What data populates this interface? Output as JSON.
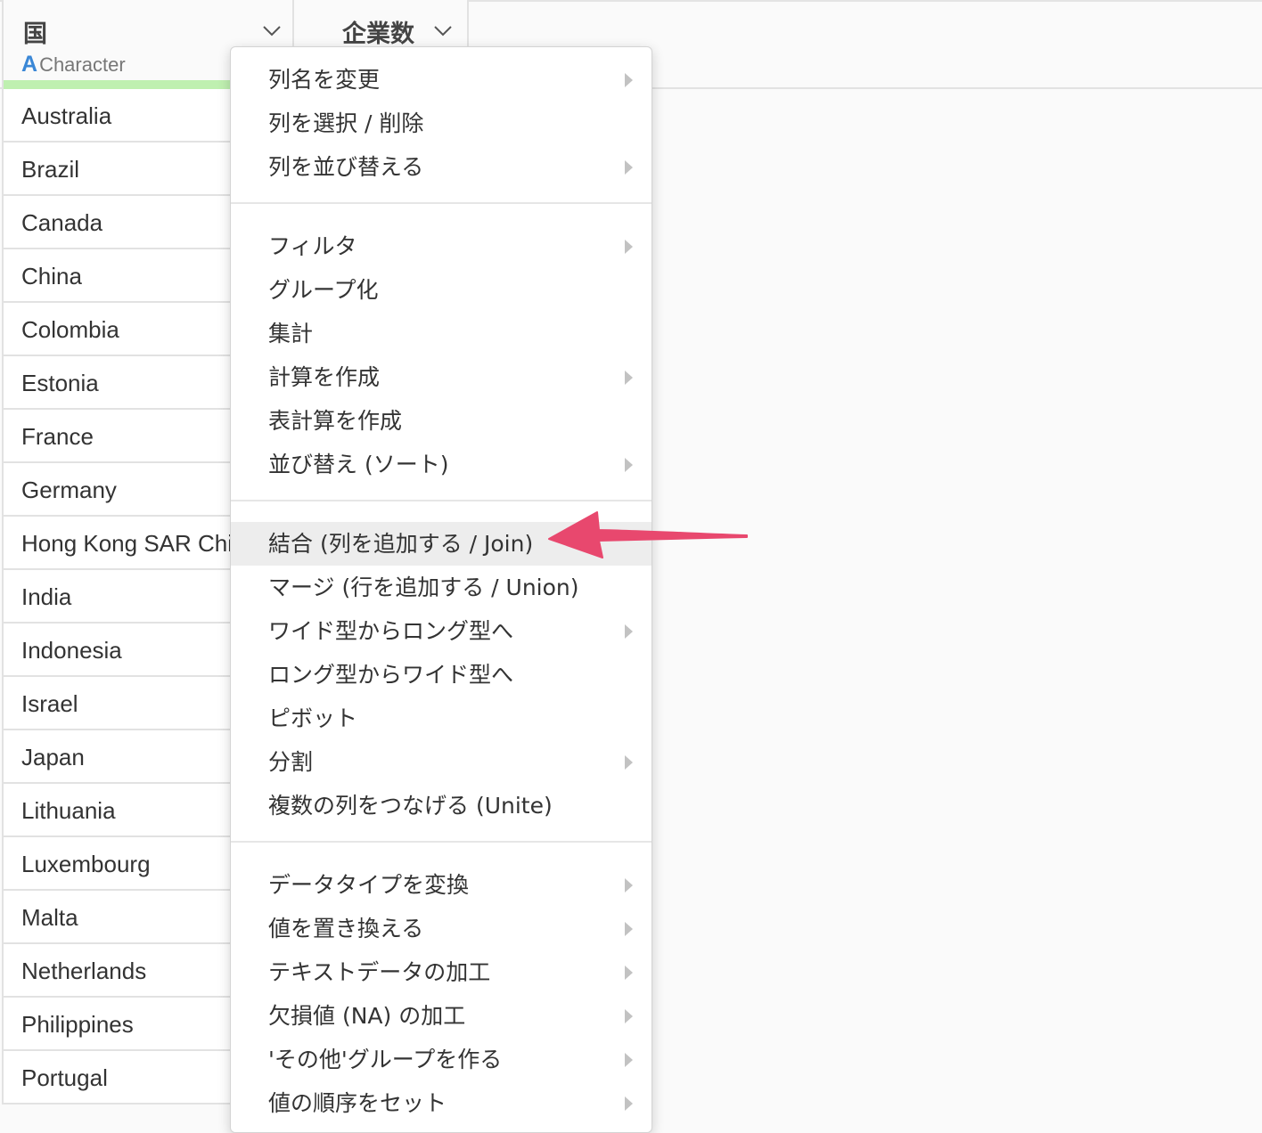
{
  "table": {
    "columns": [
      {
        "name": "国",
        "type_glyph": "A",
        "type": "Character"
      },
      {
        "name": "企業数"
      }
    ],
    "rows": [
      "Australia",
      "Brazil",
      "Canada",
      "China",
      "Colombia",
      "Estonia",
      "France",
      "Germany",
      "Hong Kong SAR China",
      "India",
      "Indonesia",
      "Israel",
      "Japan",
      "Lithuania",
      "Luxembourg",
      "Malta",
      "Netherlands",
      "Philippines",
      "Portugal"
    ]
  },
  "menu": {
    "items": [
      {
        "label": "列名を変更",
        "submenu": true
      },
      {
        "label": "列を選択 / 削除",
        "submenu": false
      },
      {
        "label": "列を並び替える",
        "submenu": true
      },
      {
        "label": "フィルタ",
        "submenu": true
      },
      {
        "label": "グループ化",
        "submenu": false
      },
      {
        "label": "集計",
        "submenu": false
      },
      {
        "label": "計算を作成",
        "submenu": true
      },
      {
        "label": "表計算を作成",
        "submenu": false
      },
      {
        "label": "並び替え (ソート)",
        "submenu": true
      },
      {
        "label": "結合 (列を追加する / Join)",
        "submenu": false,
        "highlighted": true
      },
      {
        "label": "マージ (行を追加する / Union)",
        "submenu": false
      },
      {
        "label": "ワイド型からロング型へ",
        "submenu": true
      },
      {
        "label": "ロング型からワイド型へ",
        "submenu": false
      },
      {
        "label": "ピボット",
        "submenu": false
      },
      {
        "label": "分割",
        "submenu": true
      },
      {
        "label": "複数の列をつなげる (Unite)",
        "submenu": false
      },
      {
        "label": "データタイプを変換",
        "submenu": true
      },
      {
        "label": "値を置き換える",
        "submenu": true
      },
      {
        "label": "テキストデータの加工",
        "submenu": true
      },
      {
        "label": "欠損値 (NA) の加工",
        "submenu": true
      },
      {
        "label": "'その他'グループを作る",
        "submenu": true
      },
      {
        "label": "値の順序をセット",
        "submenu": true
      }
    ]
  },
  "annotation": {
    "arrow_color": "#e8486e"
  }
}
